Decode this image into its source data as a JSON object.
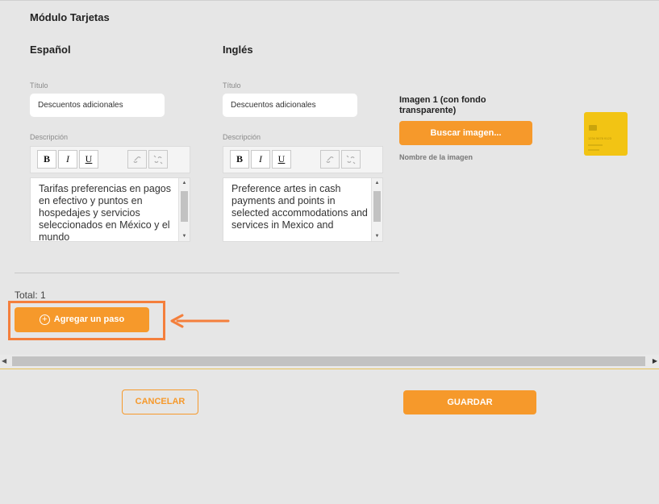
{
  "module": {
    "title": "Módulo Tarjetas"
  },
  "spanish": {
    "heading": "Español",
    "title_label": "Título",
    "title_value": "Descuentos adicionales",
    "description_label": "Descripción",
    "description_text": "Tarifas preferencias en pagos en efectivo y puntos en hospedajes y servicios seleccionados en México y el mundo"
  },
  "english": {
    "heading": "Inglés",
    "title_label": "Título",
    "title_value": "Descuentos adicionales",
    "description_label": "Descripción",
    "description_text": "Preference artes in cash payments and points in selected accommodations and services in Mexico and"
  },
  "toolbar": {
    "bold": "B",
    "italic": "I",
    "underline": "U"
  },
  "image": {
    "label": "Imagen 1 (con fondo transparente)",
    "button": "Buscar imagen...",
    "name_label": "Nombre de la imagen",
    "card_number": "1234 5678 9123"
  },
  "steps": {
    "total": "Total: 1",
    "add_button": "Agregar un paso"
  },
  "actions": {
    "cancel": "CANCELAR",
    "save": "GUARDAR"
  },
  "colors": {
    "accent": "#f6992b",
    "highlight": "#f47f3c",
    "background": "#e6e6e6"
  }
}
